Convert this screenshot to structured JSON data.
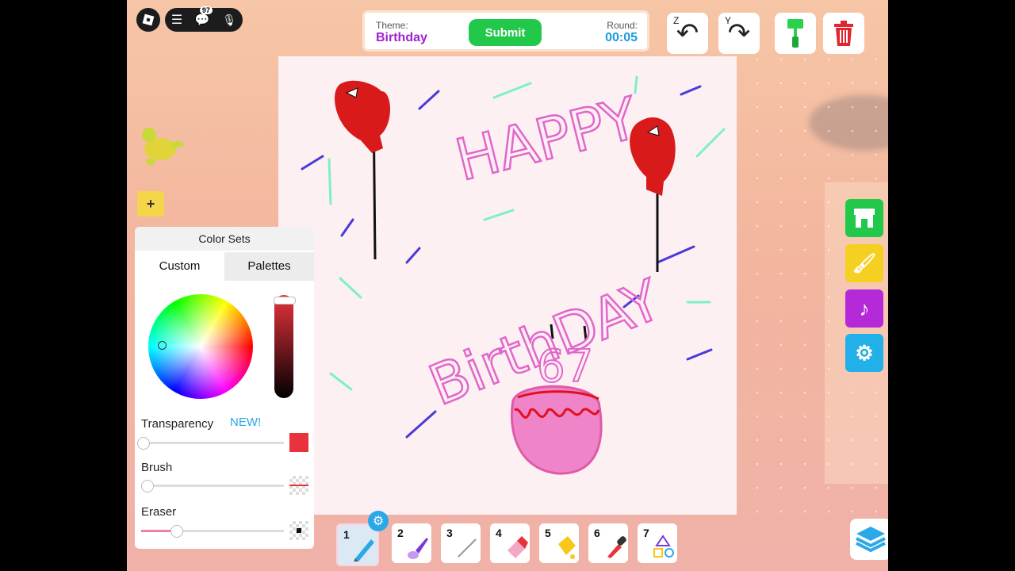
{
  "header": {
    "theme_label": "Theme:",
    "theme_value": "Birthday",
    "submit_label": "Submit",
    "round_label": "Round:",
    "round_value": "00:05",
    "notification_count": "97",
    "undo_key": "Z",
    "redo_key": "Y"
  },
  "canvas": {
    "text_happy": "HAPPY",
    "text_birthday": "BirthDAY",
    "cake_number": "67"
  },
  "color_panel": {
    "title": "Color Sets",
    "tabs": [
      "Custom",
      "Palettes"
    ],
    "active_tab": "Custom",
    "transparency_label": "Transparency",
    "new_tag": "NEW!",
    "brush_label": "Brush",
    "eraser_label": "Eraser",
    "current_color": "#e8323c",
    "transparency_value": 0,
    "brush_value": 0,
    "eraser_value": 0.25
  },
  "side_buttons": [
    {
      "name": "shop-icon",
      "color": "#22c84a"
    },
    {
      "name": "paint-plus-icon",
      "color": "#f5d020"
    },
    {
      "name": "music-icon",
      "color": "#b42ad8"
    },
    {
      "name": "settings-icon",
      "color": "#22b0e8"
    }
  ],
  "toolbar": {
    "slots": [
      {
        "num": "1",
        "tool": "pencil"
      },
      {
        "num": "2",
        "tool": "paintbrush"
      },
      {
        "num": "3",
        "tool": "line"
      },
      {
        "num": "4",
        "tool": "eraser"
      },
      {
        "num": "5",
        "tool": "fill-bucket"
      },
      {
        "num": "6",
        "tool": "eyedropper"
      },
      {
        "num": "7",
        "tool": "shapes"
      }
    ],
    "active_slot": "1"
  }
}
